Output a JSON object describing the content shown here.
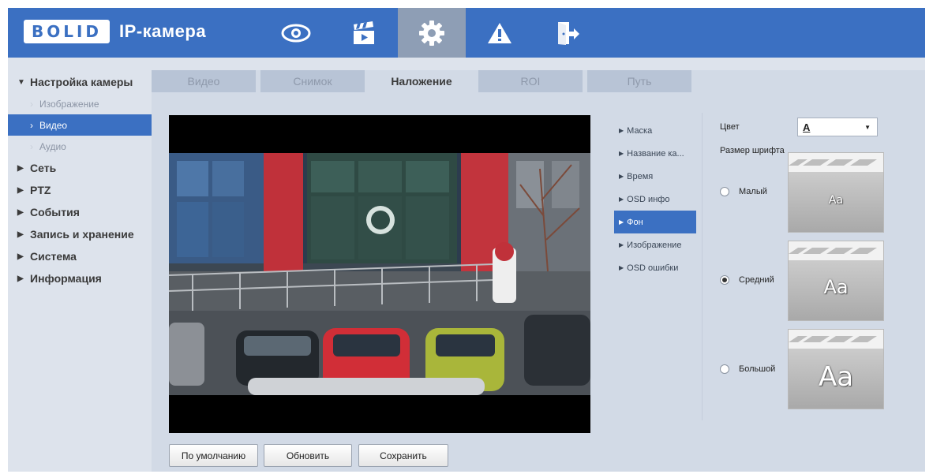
{
  "header": {
    "logo_letters": "BOLID",
    "title": "IP-камера",
    "nav": [
      {
        "icon": "eye-icon",
        "label": "live"
      },
      {
        "icon": "playback-clapper-icon",
        "label": "playback"
      },
      {
        "icon": "gear-icon",
        "label": "settings",
        "active": true
      },
      {
        "icon": "warning-icon",
        "label": "alarm"
      },
      {
        "icon": "logout-icon",
        "label": "logout"
      }
    ],
    "accent_color": "#3b70c2"
  },
  "sidebar": {
    "items": [
      {
        "label": "Настройка камеры",
        "level": 1,
        "expanded": true
      },
      {
        "label": "Изображение",
        "level": 2
      },
      {
        "label": "Видео",
        "level": 2,
        "active": true
      },
      {
        "label": "Аудио",
        "level": 2
      },
      {
        "label": "Сеть",
        "level": 1
      },
      {
        "label": "PTZ",
        "level": 1
      },
      {
        "label": "События",
        "level": 1
      },
      {
        "label": "Запись и хранение",
        "level": 1
      },
      {
        "label": "Система",
        "level": 1
      },
      {
        "label": "Информация",
        "level": 1
      }
    ]
  },
  "tabs": [
    {
      "label": "Видео"
    },
    {
      "label": "Снимок"
    },
    {
      "label": "Наложение",
      "active": true
    },
    {
      "label": "ROI"
    },
    {
      "label": "Путь"
    }
  ],
  "overlay_list": [
    {
      "label": "Маска"
    },
    {
      "label": "Название ка..."
    },
    {
      "label": "Время"
    },
    {
      "label": "OSD инфо"
    },
    {
      "label": "Фон",
      "active": true
    },
    {
      "label": "Изображение"
    },
    {
      "label": "OSD ошибки"
    }
  ],
  "settings": {
    "color_label": "Цвет",
    "color_value": "A",
    "font_size_label": "Размер шрифта",
    "sizes": [
      {
        "label": "Малый",
        "selected": false,
        "preview": "Aa"
      },
      {
        "label": "Средний",
        "selected": true,
        "preview": "Aa"
      },
      {
        "label": "Большой",
        "selected": false,
        "preview": "Aa"
      }
    ]
  },
  "buttons": {
    "default": "По умолчанию",
    "refresh": "Обновить",
    "save": "Сохранить"
  }
}
